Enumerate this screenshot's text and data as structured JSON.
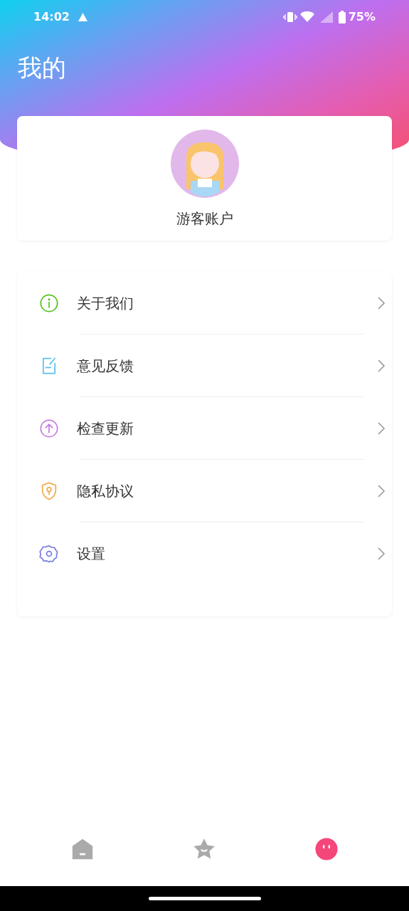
{
  "status_bar": {
    "time": "14:02",
    "battery": "75%"
  },
  "header": {
    "title": "我的"
  },
  "profile": {
    "name": "游客账户"
  },
  "menu": [
    {
      "kind": "info",
      "label": "关于我们",
      "color": "#52c41a"
    },
    {
      "kind": "feedback",
      "label": "意见反馈",
      "color": "#5bc0eb"
    },
    {
      "kind": "update",
      "label": "检查更新",
      "color": "#c77dde"
    },
    {
      "kind": "privacy",
      "label": "隐私协议",
      "color": "#f0ad4e"
    },
    {
      "kind": "settings",
      "label": "设置",
      "color": "#7b7fe0"
    }
  ],
  "tabs": [
    {
      "kind": "home",
      "selected": false
    },
    {
      "kind": "star",
      "selected": false
    },
    {
      "kind": "me",
      "selected": true
    }
  ]
}
